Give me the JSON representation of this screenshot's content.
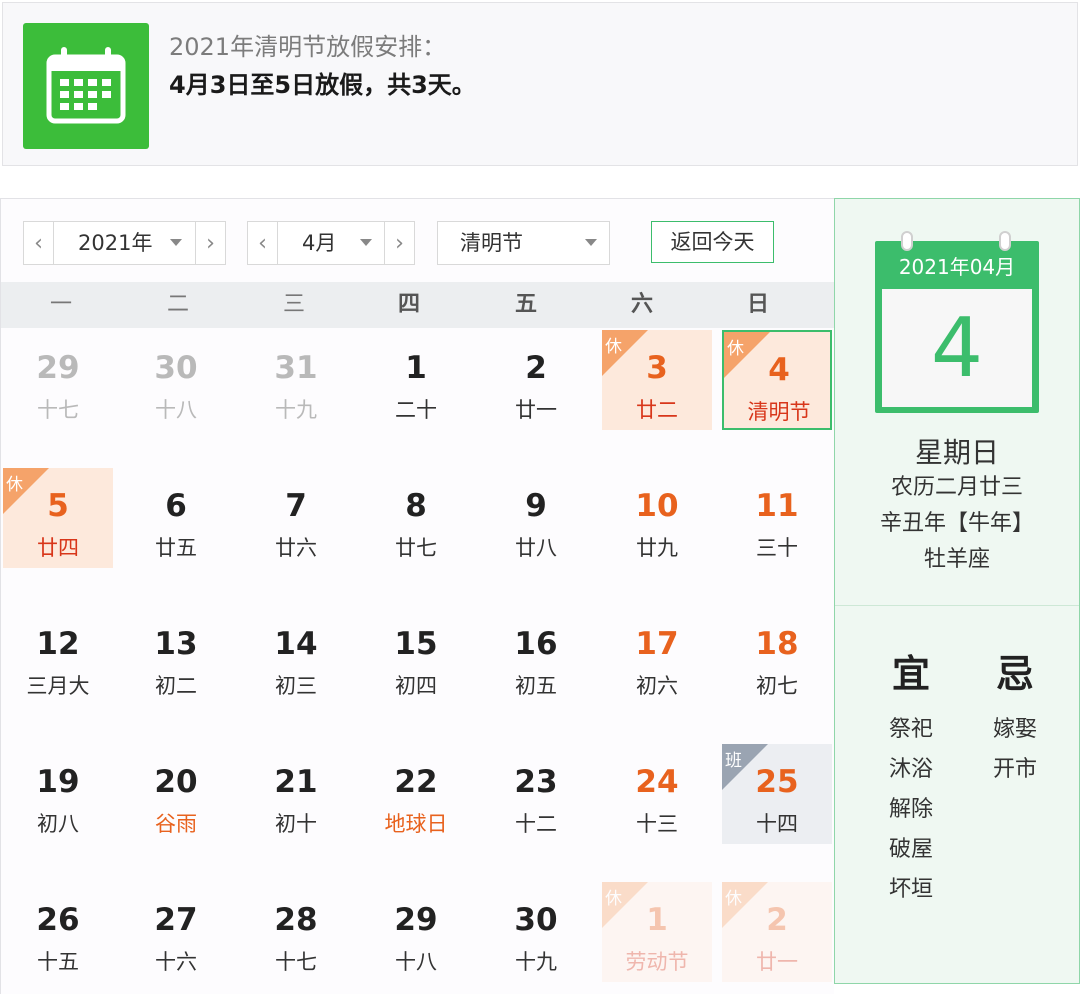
{
  "notice": {
    "icon": "calendar-icon",
    "title": "2021年清明节放假安排：",
    "text": "4月3日至5日放假，共3天。"
  },
  "controls": {
    "year": "2021年",
    "month": "4月",
    "holiday": "清明节",
    "today_button": "返回今天"
  },
  "weekdays": [
    "一",
    "二",
    "三",
    "四",
    "五",
    "六",
    "日"
  ],
  "colors": {
    "accent_green": "#3cbd6c",
    "holiday_orange": "#e8621e",
    "holiday_bg": "#fde9dc"
  },
  "calendar": {
    "weeks": [
      [
        {
          "d": "29",
          "l": "十七",
          "type": "other"
        },
        {
          "d": "30",
          "l": "十八",
          "type": "other"
        },
        {
          "d": "31",
          "l": "十九",
          "type": "other"
        },
        {
          "d": "1",
          "l": "二十",
          "type": "normal"
        },
        {
          "d": "2",
          "l": "廿一",
          "type": "normal"
        },
        {
          "d": "3",
          "l": "廿二",
          "type": "holiday",
          "tag": "休"
        },
        {
          "d": "4",
          "l": "清明节",
          "type": "holiday",
          "tag": "休",
          "today": true
        }
      ],
      [
        {
          "d": "5",
          "l": "廿四",
          "type": "holiday",
          "tag": "休"
        },
        {
          "d": "6",
          "l": "廿五",
          "type": "normal"
        },
        {
          "d": "7",
          "l": "廿六",
          "type": "normal"
        },
        {
          "d": "8",
          "l": "廿七",
          "type": "normal"
        },
        {
          "d": "9",
          "l": "廿八",
          "type": "normal"
        },
        {
          "d": "10",
          "l": "廿九",
          "type": "weekend"
        },
        {
          "d": "11",
          "l": "三十",
          "type": "weekend"
        }
      ],
      [
        {
          "d": "12",
          "l": "三月大",
          "type": "normal"
        },
        {
          "d": "13",
          "l": "初二",
          "type": "normal"
        },
        {
          "d": "14",
          "l": "初三",
          "type": "normal"
        },
        {
          "d": "15",
          "l": "初四",
          "type": "normal"
        },
        {
          "d": "16",
          "l": "初五",
          "type": "normal"
        },
        {
          "d": "17",
          "l": "初六",
          "type": "weekend"
        },
        {
          "d": "18",
          "l": "初七",
          "type": "weekend"
        }
      ],
      [
        {
          "d": "19",
          "l": "初八",
          "type": "normal"
        },
        {
          "d": "20",
          "l": "谷雨",
          "type": "festival"
        },
        {
          "d": "21",
          "l": "初十",
          "type": "normal"
        },
        {
          "d": "22",
          "l": "地球日",
          "type": "festival"
        },
        {
          "d": "23",
          "l": "十二",
          "type": "normal"
        },
        {
          "d": "24",
          "l": "十三",
          "type": "weekend"
        },
        {
          "d": "25",
          "l": "十四",
          "type": "work",
          "tag": "班"
        }
      ],
      [
        {
          "d": "26",
          "l": "十五",
          "type": "normal"
        },
        {
          "d": "27",
          "l": "十六",
          "type": "normal"
        },
        {
          "d": "28",
          "l": "十七",
          "type": "normal"
        },
        {
          "d": "29",
          "l": "十八",
          "type": "normal"
        },
        {
          "d": "30",
          "l": "十九",
          "type": "normal"
        },
        {
          "d": "1",
          "l": "劳动节",
          "type": "holiday-other",
          "tag": "休"
        },
        {
          "d": "2",
          "l": "廿一",
          "type": "holiday-other",
          "tag": "休"
        }
      ]
    ]
  },
  "side": {
    "year_month": "2021年04月",
    "day": "4",
    "weekday": "星期日",
    "lunar": "农历二月廿三",
    "ganzhi": "辛丑年【牛年】",
    "zodiac": "牡羊座",
    "yi_title": "宜",
    "yi": [
      "祭祀",
      "沐浴",
      "解除",
      "破屋",
      "坏垣"
    ],
    "ji_title": "忌",
    "ji": [
      "嫁娶",
      "开市"
    ]
  }
}
